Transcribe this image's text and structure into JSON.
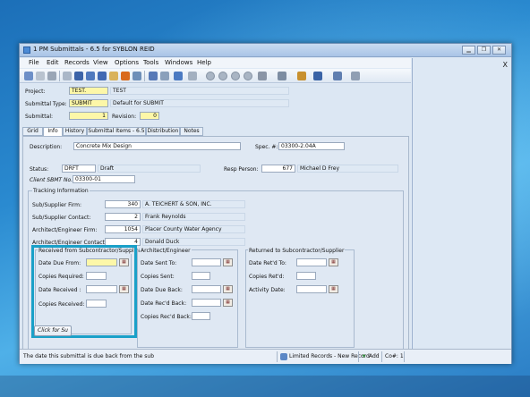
{
  "window": {
    "title": "1 PM Submittals - 6.5 for SYBLON REID",
    "minimize_glyph": "▁",
    "restore_glyph": "❐",
    "close_glyph": "✕"
  },
  "menu": [
    "File",
    "Edit",
    "Records",
    "View",
    "Options",
    "Tools",
    "Windows",
    "Help"
  ],
  "right_panel": {
    "close_glyph": "X"
  },
  "header": {
    "project_label": "Project:",
    "project_value": "TEST.",
    "project_name": "TEST",
    "submittal_type_label": "Submittal Type:",
    "submittal_type_value": "SUBMIT",
    "submittal_type_desc": "Default for SUBMIT",
    "submittal_label": "Submittal:",
    "submittal_value": "1",
    "revision_label": "Revision:",
    "revision_value": "0"
  },
  "tabs": [
    "Grid",
    "Info",
    "History",
    "Submittal Items - 6.5",
    "Distribution",
    "Notes"
  ],
  "info": {
    "description_label": "Description:",
    "description_value": "Concrete Mix Design",
    "spec_label": "Spec. #:",
    "spec_value": "03300-2.04A",
    "status_label": "Status:",
    "status_value": "DRFT",
    "status_desc": "Draft",
    "resp_label": "Resp Person:",
    "resp_value": "677",
    "resp_name": "Michael D Frey",
    "client_label": "Client SBMT No.:",
    "client_value": "03300-01"
  },
  "tracking": {
    "title": "Tracking Information",
    "rows": [
      {
        "label": "Sub/Supplier Firm:",
        "code": "340",
        "name": "A. TEICHERT & SON, INC."
      },
      {
        "label": "Sub/Supplier Contact:",
        "code": "2",
        "name": "Frank   Reynolds"
      },
      {
        "label": "Architect/Engineer Firm:",
        "code": "1054",
        "name": "Placer County Water Agency"
      },
      {
        "label": "Architect/Engineer Contact:",
        "code": "4",
        "name": "Donald   Duck"
      }
    ]
  },
  "received": {
    "title": "Received from Subcontractor/Supplier",
    "date_due_from": "Date Due From:",
    "copies_required": "Copies Required:",
    "date_received": "Date Received :",
    "copies_received": "Copies Received:"
  },
  "architect": {
    "title": "Architect/Engineer",
    "date_sent_to": "Date Sent To:",
    "copies_sent": "Copies Sent:",
    "date_due_back": "Date Due Back:",
    "date_recd_back": "Date Rec'd Back:",
    "copies_recd_back": "Copies Rec'd Back:"
  },
  "returned": {
    "title": "Returned to Subcontractor/Supplier",
    "date_retd_to": "Date Ret'd To:",
    "copies_retd": "Copies Ret'd:",
    "activity_date": "Activity Date:"
  },
  "calendar_glyph": "▦",
  "click_button": "Click for Su",
  "statusbar": {
    "message": "The date this submittal is due back from the sub",
    "records": "Limited Records - New Record",
    "add": "Add",
    "co": "Co#: 1"
  },
  "colors": {
    "highlight": "#1aa0c8",
    "yellow_field": "#fdf7a8"
  }
}
